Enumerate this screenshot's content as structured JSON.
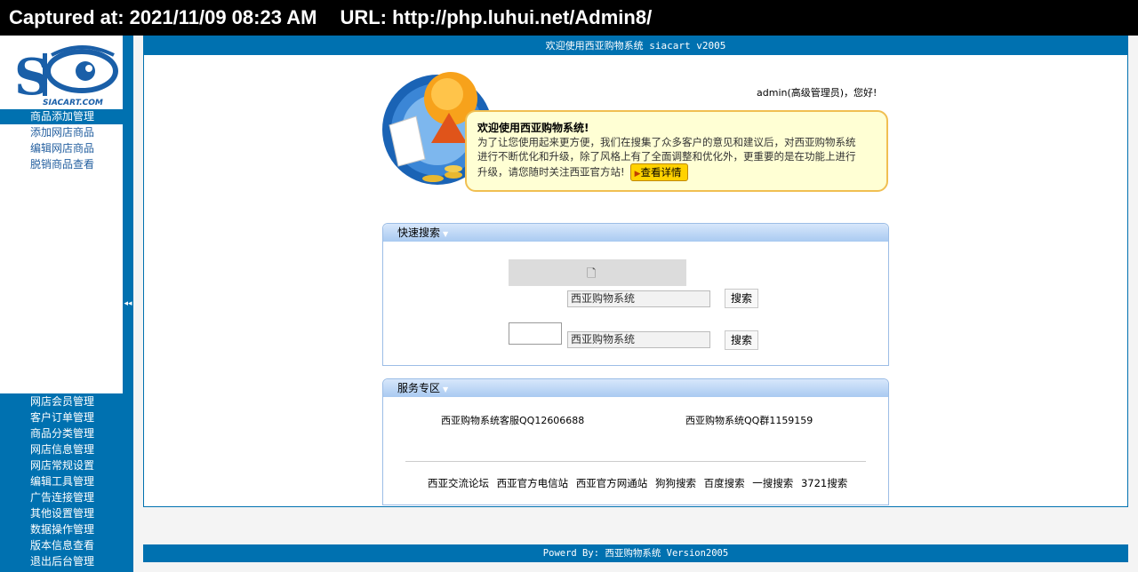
{
  "capture": {
    "captured_label": "Captured at: 2021/11/09 08:23 AM",
    "url_label": "URL: http://php.luhui.net/Admin8/"
  },
  "sidebar": {
    "logo_text": "SIACART.COM",
    "collapse_symbol": "◂◂",
    "active_group": {
      "label": "商品添加管理",
      "items": [
        {
          "label": "添加网店商品"
        },
        {
          "label": "编辑网店商品"
        },
        {
          "label": "脱销商品查看"
        }
      ]
    },
    "menu": [
      {
        "label": "网店会员管理"
      },
      {
        "label": "客户订单管理"
      },
      {
        "label": "商品分类管理"
      },
      {
        "label": "网店信息管理"
      },
      {
        "label": "网店常规设置"
      },
      {
        "label": "编辑工具管理"
      },
      {
        "label": "广告连接管理"
      },
      {
        "label": "其他设置管理"
      },
      {
        "label": "数据操作管理"
      },
      {
        "label": "版本信息查看"
      },
      {
        "label": "退出后台管理"
      }
    ]
  },
  "main": {
    "title": "欢迎使用西亚购物系统 siacart v2005",
    "greeting": "admin(高级管理员)，您好!",
    "welcome": {
      "title": "欢迎使用西亚购物系统!",
      "line1": "为了让您使用起来更方便，我们在搜集了众多客户的意见和建议后，对西亚购物系统",
      "line2": "进行不断优化和升级，除了风格上有了全面调整和优化外，更重要的是在功能上进行",
      "line3": "升级，请您随时关注西亚官方站!",
      "detail_button": "查看详情"
    },
    "quick_search": {
      "title": "快速搜索",
      "input1_value": "西亚购物系统",
      "input2_value": "西亚购物系统",
      "button_label": "搜索"
    },
    "service": {
      "title": "服务专区",
      "support_qq": "西亚购物系统客服QQ12606688",
      "qq_group": "西亚购物系统QQ群1159159",
      "links": [
        "西亚交流论坛",
        "西亚官方电信站",
        "西亚官方网通站",
        "狗狗搜索",
        "百度搜索",
        "一搜搜索",
        "3721搜索"
      ]
    }
  },
  "footer": {
    "text": "Powerd By: 西亚购物系统 Version2005"
  },
  "colors": {
    "primary_blue": "#0071b0",
    "panel_header": "#a9caf1",
    "welcome_bg": "#ffffd4",
    "welcome_border": "#f0bf52"
  }
}
